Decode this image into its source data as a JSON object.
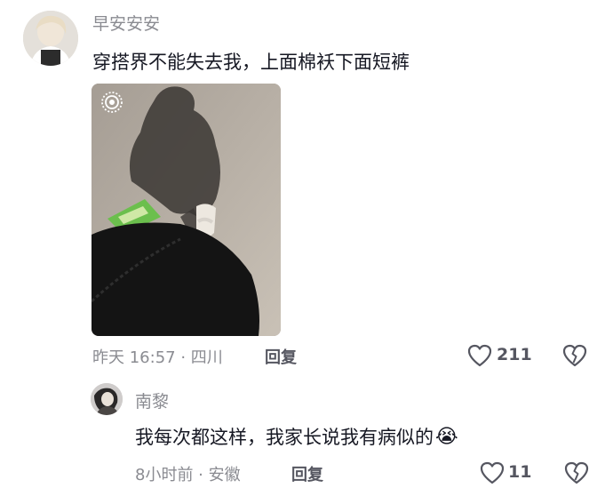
{
  "comment": {
    "username": "早安安安",
    "text": "穿搭界不能失去我，上面棉袄下面短裤",
    "meta": "昨天 16:57 · 四川",
    "reply_label": "回复",
    "like_count": "211"
  },
  "reply": {
    "username": "南黎",
    "text": "我每次都这样，我家长说我有病似的",
    "emoji": "😭",
    "meta": "8小时前 · 安徽",
    "reply_label": "回复",
    "like_count": "11"
  }
}
